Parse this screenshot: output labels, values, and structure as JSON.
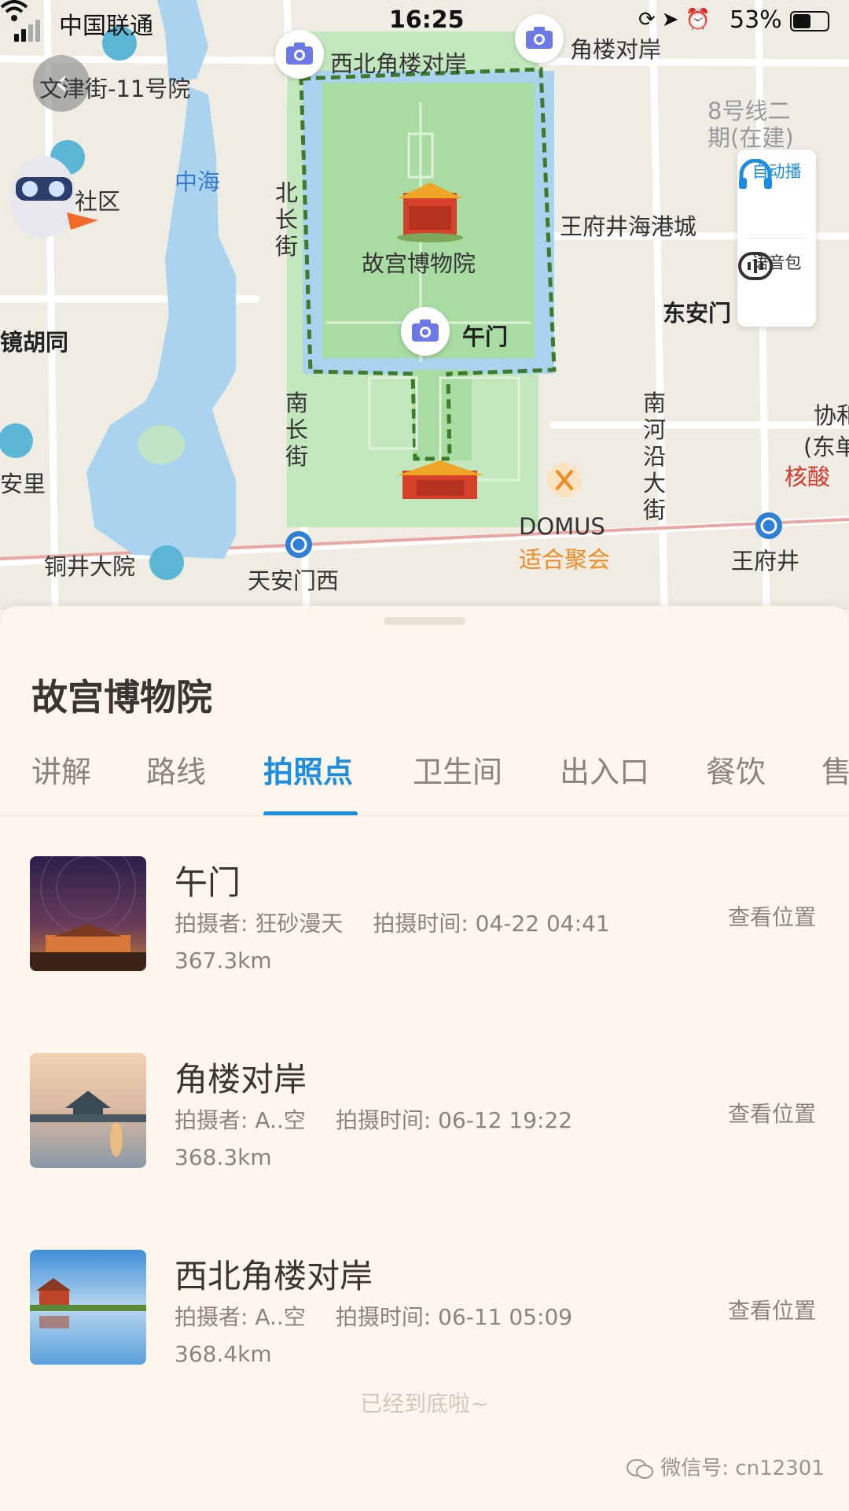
{
  "status_bar": {
    "carrier": "中国联通",
    "time": "16:25",
    "battery": "53%"
  },
  "map": {
    "back_label": "文津街-11号院",
    "labels": {
      "zhonghai": "中海",
      "beichangjie": "北长街",
      "nanchangjie": "南长街",
      "nanheyan": "南河沿大街",
      "gugong": "故宫博物院",
      "wumen": "午门",
      "xibei": "西北角楼对岸",
      "jiaolou": "角楼对岸",
      "line8": "8号线二",
      "line8b": "期(在建)",
      "wangfujing_haigang": "王府井海港城",
      "dongan": "东安门",
      "xiehe": "协和",
      "dongdan": "(东单",
      "hesuan": "核酸",
      "shequ": "社区",
      "jinghutong": "镜胡同",
      "anli": "安里",
      "tongjing": "铜井大院",
      "tiananmenxi": "天安门西",
      "domus": "DOMUS",
      "shihe": "适合聚会",
      "wangfujing": "王府井"
    },
    "side_panel": {
      "auto_play": "自动播",
      "voice_pack": "语音包"
    },
    "colors": {
      "park": "#a8dca2",
      "water": "#a9d3ee",
      "boundary": "#3d7a2a",
      "accent": "#1c8ddf"
    }
  },
  "sheet": {
    "title": "故宫博物院",
    "tabs": [
      "讲解",
      "路线",
      "拍照点",
      "卫生间",
      "出入口",
      "餐饮",
      "售"
    ],
    "active_tab": "拍照点",
    "items": [
      {
        "name": "午门",
        "author": "拍摄者: 狂砂漫天",
        "time": "拍摄时间: 04-22 04:41",
        "distance": "367.3km",
        "action": "查看位置"
      },
      {
        "name": "角楼对岸",
        "author": "拍摄者: A..空",
        "time": "拍摄时间: 06-12 19:22",
        "distance": "368.3km",
        "action": "查看位置"
      },
      {
        "name": "西北角楼对岸",
        "author": "拍摄者: A..空",
        "time": "拍摄时间: 06-11 05:09",
        "distance": "368.4km",
        "action": "查看位置"
      }
    ],
    "end_text": "已经到底啦~",
    "watermark": "微信号: cn12301"
  }
}
